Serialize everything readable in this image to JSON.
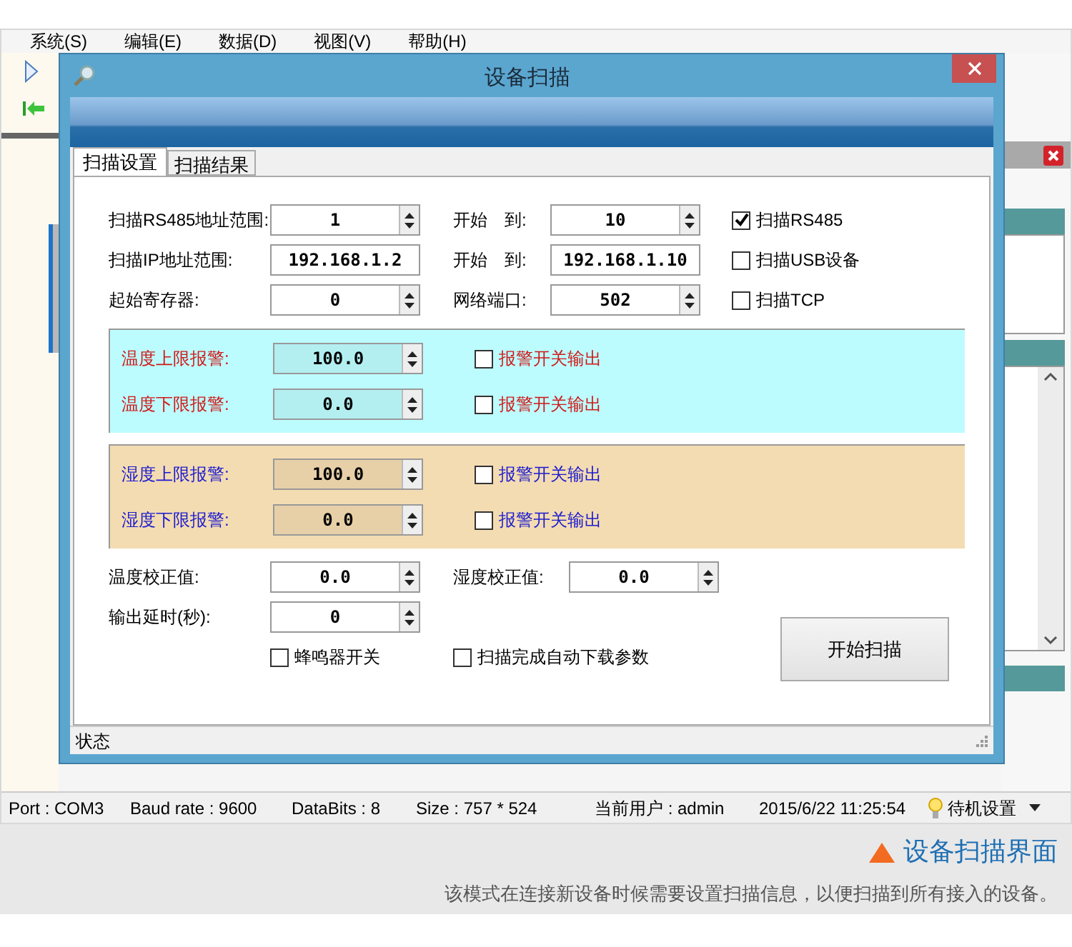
{
  "app": {
    "menu": [
      {
        "label": "系统(S)"
      },
      {
        "label": "编辑(E)"
      },
      {
        "label": "数据(D)"
      },
      {
        "label": "视图(V)"
      },
      {
        "label": "帮助(H)"
      }
    ]
  },
  "dialog": {
    "title": "设备扫描",
    "tabs": [
      {
        "label": "扫描设置",
        "selected": true
      },
      {
        "label": "扫描结果",
        "selected": false
      }
    ],
    "address_rows": [
      {
        "label": "扫描RS485地址范围:",
        "start": {
          "kind": "spinner",
          "value": "1"
        },
        "to_label": "开始　到:",
        "end": {
          "kind": "spinner",
          "value": "10"
        },
        "option": {
          "label": "扫描RS485",
          "checked": true
        }
      },
      {
        "label": "扫描IP地址范围:",
        "start": {
          "kind": "text",
          "value": "192.168.1.2"
        },
        "to_label": "开始　到:",
        "end": {
          "kind": "text",
          "value": "192.168.1.10"
        },
        "option": {
          "label": "扫描USB设备",
          "checked": false
        }
      },
      {
        "label": "起始寄存器:",
        "start": {
          "kind": "spinner",
          "value": "0"
        },
        "to_label": "网络端口:",
        "end": {
          "kind": "spinner",
          "value": "502"
        },
        "option": {
          "label": "扫描TCP",
          "checked": false
        }
      }
    ],
    "alarm_groups": [
      {
        "kind": "temperature",
        "rows": [
          {
            "label": "温度上限报警:",
            "value": "100.0",
            "output_label": "报警开关输出",
            "checked": false
          },
          {
            "label": "温度下限报警:",
            "value": "0.0",
            "output_label": "报警开关输出",
            "checked": false
          }
        ]
      },
      {
        "kind": "humidity",
        "rows": [
          {
            "label": "湿度上限报警:",
            "value": "100.0",
            "output_label": "报警开关输出",
            "checked": false
          },
          {
            "label": "湿度下限报警:",
            "value": "0.0",
            "output_label": "报警开关输出",
            "checked": false
          }
        ]
      }
    ],
    "temp_correction": {
      "label": "温度校正值:",
      "value": "0.0"
    },
    "humidity_correction": {
      "label": "湿度校正值:",
      "value": "0.0"
    },
    "output_delay": {
      "label": "输出延时(秒):",
      "value": "0"
    },
    "buzzer": {
      "label": "蜂鸣器开关",
      "checked": false
    },
    "auto_download": {
      "label": "扫描完成自动下载参数",
      "checked": false
    },
    "start_button": "开始扫描",
    "status": "状态"
  },
  "status_bar": [
    "Port : COM3",
    "Baud rate  : 9600",
    "DataBits : 8",
    "Size : 757 * 524",
    "当前用户 : admin",
    "2015/6/22 11:25:54",
    "待机设置"
  ],
  "caption": {
    "title": "设备扫描界面",
    "description": "该模式在连接新设备时候需要设置扫描信息，以便扫描到所有接入的设备。"
  }
}
